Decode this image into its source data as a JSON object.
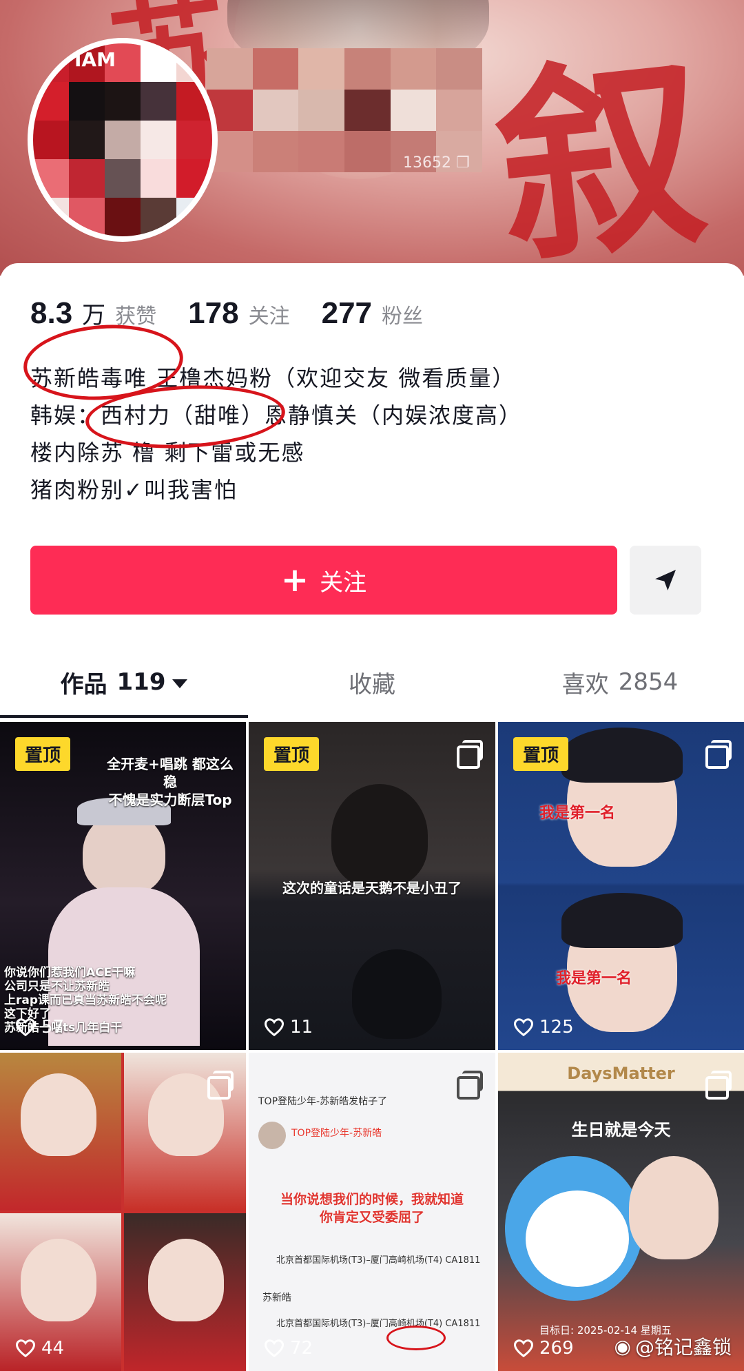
{
  "header": {
    "avatar_label": "IAM",
    "count_tag": "13652"
  },
  "stats": {
    "likes_value": "8.3",
    "likes_unit": "万",
    "likes_label": "获赞",
    "following_value": "178",
    "following_label": "关注",
    "followers_value": "277",
    "followers_label": "粉丝"
  },
  "bio": {
    "line1": "苏新皓毒唯 王橹杰妈粉（欢迎交友 微看质量）",
    "line2": "韩娱：西村力（甜唯）恩静慎关（内娱浓度高）",
    "line3": "楼内除苏 橹 剩下雷或无感",
    "line4": "猪肉粉别✓叫我害怕"
  },
  "actions": {
    "follow_label": "关注",
    "share_icon": "send-icon"
  },
  "tabs": {
    "works_label": "作品",
    "works_count": "119",
    "favorites_label": "收藏",
    "likes_label": "喜欢",
    "likes_count": "2854"
  },
  "posts": [
    {
      "pinned": "置顶",
      "likes": "57",
      "caption_top": "全开麦+唱跳 都这么稳\n不愧是实力断层Top",
      "caption_bottom": "你说你们惹我们ACE干嘛\n公司只是不让苏新皓\n上rap课而已真当苏新皓不会呢\n这下好了\n苏新皓一唱ts几年白干"
    },
    {
      "pinned": "置顶",
      "likes": "11",
      "caption": "这次的童话是天鹅不是小丑了"
    },
    {
      "pinned": "置顶",
      "likes": "125",
      "caption_top": "我是第一名",
      "caption_bottom": "我是第一名"
    },
    {
      "likes": "44"
    },
    {
      "likes": "72",
      "post_title": "TOP登陆少年-苏新皓发帖子了",
      "user": "TOP登陆少年-苏新皓",
      "quote": "当你说想我们的时候，我就知道\n你肯定又受委屈了",
      "flight1": "北京首都国际机场(T3)–厦门高崎机场(T4)  CA1811",
      "flight2": "北京首都国际机场(T3)–厦门高崎机场(T4)  CA1811",
      "name": "苏新皓"
    },
    {
      "likes": "269",
      "app_name": "DaysMatter",
      "caption": "生日就是今天",
      "date": "目标日: 2025-02-14 星期五"
    }
  ],
  "watermark": "@铭记鑫锁",
  "colors": {
    "accent": "#fe2c55",
    "pin_badge": "#fdd82b",
    "annotation": "#d7141b"
  }
}
